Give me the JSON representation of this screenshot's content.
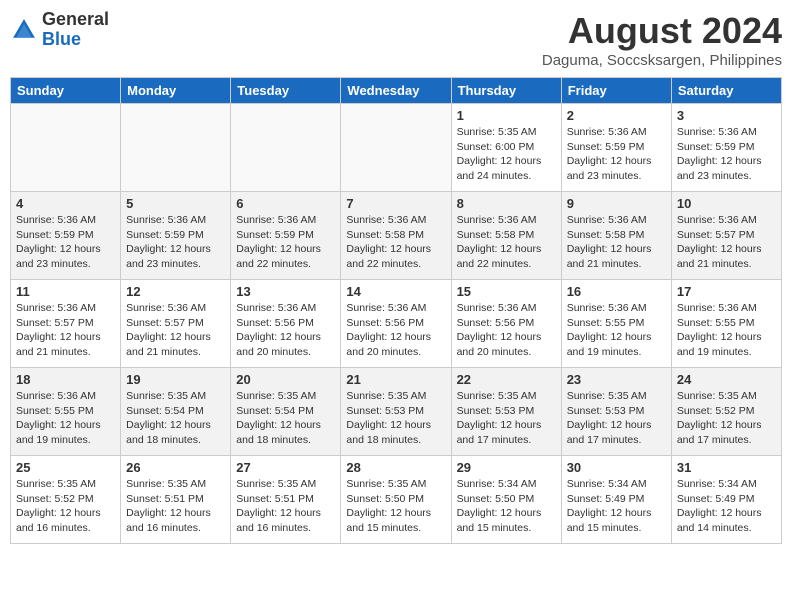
{
  "logo": {
    "general": "General",
    "blue": "Blue"
  },
  "header": {
    "month_year": "August 2024",
    "location": "Daguma, Soccsksargen, Philippines"
  },
  "weekdays": [
    "Sunday",
    "Monday",
    "Tuesday",
    "Wednesday",
    "Thursday",
    "Friday",
    "Saturday"
  ],
  "weeks": [
    [
      {
        "day": "",
        "info": ""
      },
      {
        "day": "",
        "info": ""
      },
      {
        "day": "",
        "info": ""
      },
      {
        "day": "",
        "info": ""
      },
      {
        "day": "1",
        "info": "Sunrise: 5:35 AM\nSunset: 6:00 PM\nDaylight: 12 hours\nand 24 minutes."
      },
      {
        "day": "2",
        "info": "Sunrise: 5:36 AM\nSunset: 5:59 PM\nDaylight: 12 hours\nand 23 minutes."
      },
      {
        "day": "3",
        "info": "Sunrise: 5:36 AM\nSunset: 5:59 PM\nDaylight: 12 hours\nand 23 minutes."
      }
    ],
    [
      {
        "day": "4",
        "info": "Sunrise: 5:36 AM\nSunset: 5:59 PM\nDaylight: 12 hours\nand 23 minutes."
      },
      {
        "day": "5",
        "info": "Sunrise: 5:36 AM\nSunset: 5:59 PM\nDaylight: 12 hours\nand 23 minutes."
      },
      {
        "day": "6",
        "info": "Sunrise: 5:36 AM\nSunset: 5:59 PM\nDaylight: 12 hours\nand 22 minutes."
      },
      {
        "day": "7",
        "info": "Sunrise: 5:36 AM\nSunset: 5:58 PM\nDaylight: 12 hours\nand 22 minutes."
      },
      {
        "day": "8",
        "info": "Sunrise: 5:36 AM\nSunset: 5:58 PM\nDaylight: 12 hours\nand 22 minutes."
      },
      {
        "day": "9",
        "info": "Sunrise: 5:36 AM\nSunset: 5:58 PM\nDaylight: 12 hours\nand 21 minutes."
      },
      {
        "day": "10",
        "info": "Sunrise: 5:36 AM\nSunset: 5:57 PM\nDaylight: 12 hours\nand 21 minutes."
      }
    ],
    [
      {
        "day": "11",
        "info": "Sunrise: 5:36 AM\nSunset: 5:57 PM\nDaylight: 12 hours\nand 21 minutes."
      },
      {
        "day": "12",
        "info": "Sunrise: 5:36 AM\nSunset: 5:57 PM\nDaylight: 12 hours\nand 21 minutes."
      },
      {
        "day": "13",
        "info": "Sunrise: 5:36 AM\nSunset: 5:56 PM\nDaylight: 12 hours\nand 20 minutes."
      },
      {
        "day": "14",
        "info": "Sunrise: 5:36 AM\nSunset: 5:56 PM\nDaylight: 12 hours\nand 20 minutes."
      },
      {
        "day": "15",
        "info": "Sunrise: 5:36 AM\nSunset: 5:56 PM\nDaylight: 12 hours\nand 20 minutes."
      },
      {
        "day": "16",
        "info": "Sunrise: 5:36 AM\nSunset: 5:55 PM\nDaylight: 12 hours\nand 19 minutes."
      },
      {
        "day": "17",
        "info": "Sunrise: 5:36 AM\nSunset: 5:55 PM\nDaylight: 12 hours\nand 19 minutes."
      }
    ],
    [
      {
        "day": "18",
        "info": "Sunrise: 5:36 AM\nSunset: 5:55 PM\nDaylight: 12 hours\nand 19 minutes."
      },
      {
        "day": "19",
        "info": "Sunrise: 5:35 AM\nSunset: 5:54 PM\nDaylight: 12 hours\nand 18 minutes."
      },
      {
        "day": "20",
        "info": "Sunrise: 5:35 AM\nSunset: 5:54 PM\nDaylight: 12 hours\nand 18 minutes."
      },
      {
        "day": "21",
        "info": "Sunrise: 5:35 AM\nSunset: 5:53 PM\nDaylight: 12 hours\nand 18 minutes."
      },
      {
        "day": "22",
        "info": "Sunrise: 5:35 AM\nSunset: 5:53 PM\nDaylight: 12 hours\nand 17 minutes."
      },
      {
        "day": "23",
        "info": "Sunrise: 5:35 AM\nSunset: 5:53 PM\nDaylight: 12 hours\nand 17 minutes."
      },
      {
        "day": "24",
        "info": "Sunrise: 5:35 AM\nSunset: 5:52 PM\nDaylight: 12 hours\nand 17 minutes."
      }
    ],
    [
      {
        "day": "25",
        "info": "Sunrise: 5:35 AM\nSunset: 5:52 PM\nDaylight: 12 hours\nand 16 minutes."
      },
      {
        "day": "26",
        "info": "Sunrise: 5:35 AM\nSunset: 5:51 PM\nDaylight: 12 hours\nand 16 minutes."
      },
      {
        "day": "27",
        "info": "Sunrise: 5:35 AM\nSunset: 5:51 PM\nDaylight: 12 hours\nand 16 minutes."
      },
      {
        "day": "28",
        "info": "Sunrise: 5:35 AM\nSunset: 5:50 PM\nDaylight: 12 hours\nand 15 minutes."
      },
      {
        "day": "29",
        "info": "Sunrise: 5:34 AM\nSunset: 5:50 PM\nDaylight: 12 hours\nand 15 minutes."
      },
      {
        "day": "30",
        "info": "Sunrise: 5:34 AM\nSunset: 5:49 PM\nDaylight: 12 hours\nand 15 minutes."
      },
      {
        "day": "31",
        "info": "Sunrise: 5:34 AM\nSunset: 5:49 PM\nDaylight: 12 hours\nand 14 minutes."
      }
    ]
  ]
}
